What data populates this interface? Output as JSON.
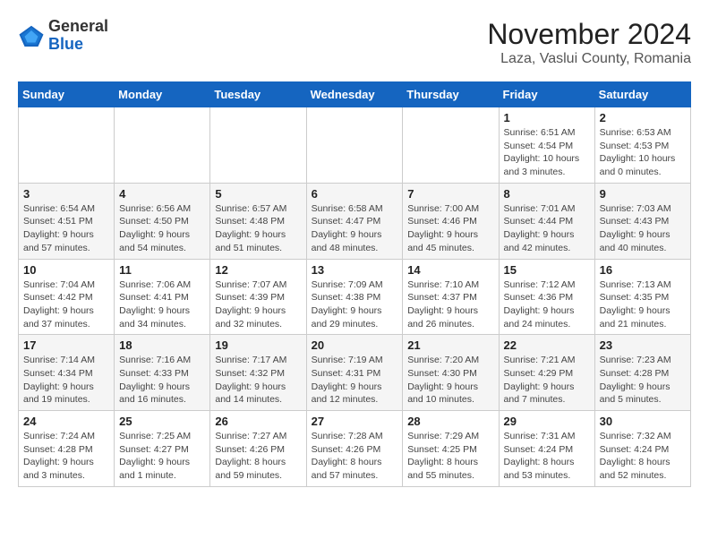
{
  "header": {
    "logo": {
      "line1": "General",
      "line2": "Blue"
    },
    "title": "November 2024",
    "location": "Laza, Vaslui County, Romania"
  },
  "calendar": {
    "days_of_week": [
      "Sunday",
      "Monday",
      "Tuesday",
      "Wednesday",
      "Thursday",
      "Friday",
      "Saturday"
    ],
    "weeks": [
      [
        {
          "day": "",
          "info": ""
        },
        {
          "day": "",
          "info": ""
        },
        {
          "day": "",
          "info": ""
        },
        {
          "day": "",
          "info": ""
        },
        {
          "day": "",
          "info": ""
        },
        {
          "day": "1",
          "info": "Sunrise: 6:51 AM\nSunset: 4:54 PM\nDaylight: 10 hours and 3 minutes."
        },
        {
          "day": "2",
          "info": "Sunrise: 6:53 AM\nSunset: 4:53 PM\nDaylight: 10 hours and 0 minutes."
        }
      ],
      [
        {
          "day": "3",
          "info": "Sunrise: 6:54 AM\nSunset: 4:51 PM\nDaylight: 9 hours and 57 minutes."
        },
        {
          "day": "4",
          "info": "Sunrise: 6:56 AM\nSunset: 4:50 PM\nDaylight: 9 hours and 54 minutes."
        },
        {
          "day": "5",
          "info": "Sunrise: 6:57 AM\nSunset: 4:48 PM\nDaylight: 9 hours and 51 minutes."
        },
        {
          "day": "6",
          "info": "Sunrise: 6:58 AM\nSunset: 4:47 PM\nDaylight: 9 hours and 48 minutes."
        },
        {
          "day": "7",
          "info": "Sunrise: 7:00 AM\nSunset: 4:46 PM\nDaylight: 9 hours and 45 minutes."
        },
        {
          "day": "8",
          "info": "Sunrise: 7:01 AM\nSunset: 4:44 PM\nDaylight: 9 hours and 42 minutes."
        },
        {
          "day": "9",
          "info": "Sunrise: 7:03 AM\nSunset: 4:43 PM\nDaylight: 9 hours and 40 minutes."
        }
      ],
      [
        {
          "day": "10",
          "info": "Sunrise: 7:04 AM\nSunset: 4:42 PM\nDaylight: 9 hours and 37 minutes."
        },
        {
          "day": "11",
          "info": "Sunrise: 7:06 AM\nSunset: 4:41 PM\nDaylight: 9 hours and 34 minutes."
        },
        {
          "day": "12",
          "info": "Sunrise: 7:07 AM\nSunset: 4:39 PM\nDaylight: 9 hours and 32 minutes."
        },
        {
          "day": "13",
          "info": "Sunrise: 7:09 AM\nSunset: 4:38 PM\nDaylight: 9 hours and 29 minutes."
        },
        {
          "day": "14",
          "info": "Sunrise: 7:10 AM\nSunset: 4:37 PM\nDaylight: 9 hours and 26 minutes."
        },
        {
          "day": "15",
          "info": "Sunrise: 7:12 AM\nSunset: 4:36 PM\nDaylight: 9 hours and 24 minutes."
        },
        {
          "day": "16",
          "info": "Sunrise: 7:13 AM\nSunset: 4:35 PM\nDaylight: 9 hours and 21 minutes."
        }
      ],
      [
        {
          "day": "17",
          "info": "Sunrise: 7:14 AM\nSunset: 4:34 PM\nDaylight: 9 hours and 19 minutes."
        },
        {
          "day": "18",
          "info": "Sunrise: 7:16 AM\nSunset: 4:33 PM\nDaylight: 9 hours and 16 minutes."
        },
        {
          "day": "19",
          "info": "Sunrise: 7:17 AM\nSunset: 4:32 PM\nDaylight: 9 hours and 14 minutes."
        },
        {
          "day": "20",
          "info": "Sunrise: 7:19 AM\nSunset: 4:31 PM\nDaylight: 9 hours and 12 minutes."
        },
        {
          "day": "21",
          "info": "Sunrise: 7:20 AM\nSunset: 4:30 PM\nDaylight: 9 hours and 10 minutes."
        },
        {
          "day": "22",
          "info": "Sunrise: 7:21 AM\nSunset: 4:29 PM\nDaylight: 9 hours and 7 minutes."
        },
        {
          "day": "23",
          "info": "Sunrise: 7:23 AM\nSunset: 4:28 PM\nDaylight: 9 hours and 5 minutes."
        }
      ],
      [
        {
          "day": "24",
          "info": "Sunrise: 7:24 AM\nSunset: 4:28 PM\nDaylight: 9 hours and 3 minutes."
        },
        {
          "day": "25",
          "info": "Sunrise: 7:25 AM\nSunset: 4:27 PM\nDaylight: 9 hours and 1 minute."
        },
        {
          "day": "26",
          "info": "Sunrise: 7:27 AM\nSunset: 4:26 PM\nDaylight: 8 hours and 59 minutes."
        },
        {
          "day": "27",
          "info": "Sunrise: 7:28 AM\nSunset: 4:26 PM\nDaylight: 8 hours and 57 minutes."
        },
        {
          "day": "28",
          "info": "Sunrise: 7:29 AM\nSunset: 4:25 PM\nDaylight: 8 hours and 55 minutes."
        },
        {
          "day": "29",
          "info": "Sunrise: 7:31 AM\nSunset: 4:24 PM\nDaylight: 8 hours and 53 minutes."
        },
        {
          "day": "30",
          "info": "Sunrise: 7:32 AM\nSunset: 4:24 PM\nDaylight: 8 hours and 52 minutes."
        }
      ]
    ]
  }
}
